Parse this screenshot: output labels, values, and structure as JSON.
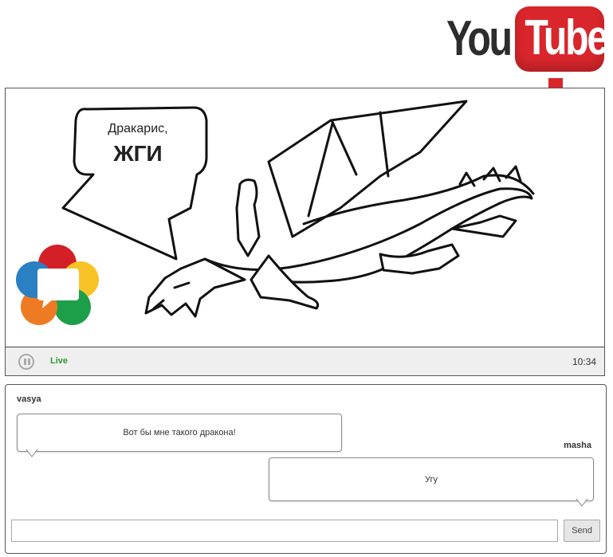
{
  "logo": {
    "part1": "You",
    "part2": "Tube",
    "icon": "youtube-logo",
    "brand_color": "#d9262c"
  },
  "arrow": {
    "icon": "down-arrow-icon",
    "color": "#d9262c"
  },
  "video": {
    "speech_bubble": {
      "line1": "Дракарис,",
      "line2": "ЖГИ"
    },
    "overlay_logo": {
      "icon": "webrtc-logo",
      "colors": [
        "#d32027",
        "#f8c326",
        "#1d9f4a",
        "#ee7b23",
        "#2b7fc3"
      ]
    }
  },
  "controls": {
    "pause_icon": "pause-icon",
    "status": "Live",
    "status_color": "#2e9a2e",
    "time": "10:34"
  },
  "chat": {
    "messages": [
      {
        "author": "vasya",
        "text": "Вот бы мне такого дракона!"
      },
      {
        "author": "masha",
        "text": "Угу"
      }
    ],
    "input": {
      "value": "",
      "placeholder": ""
    },
    "send_label": "Send"
  }
}
